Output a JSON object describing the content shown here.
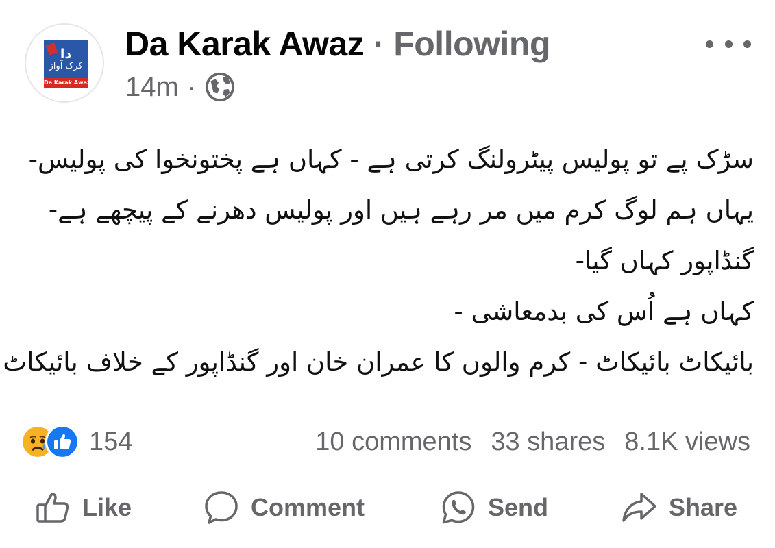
{
  "header": {
    "page_name": "Da Karak Awaz",
    "separator": "·",
    "follow_status": "Following",
    "time_ago": "14m",
    "time_separator": "·",
    "privacy_icon": "globe-icon",
    "more_icon": "more-options-icon"
  },
  "avatar": {
    "logo_mark": "دا",
    "logo_urdu": "کرک آواز",
    "logo_caption": "Da Karak Awaz"
  },
  "post": {
    "lines": [
      "سڑک پے تو پولیس پیٹرولنگ کرتی ہے - کہاں ہے پختونخوا کی پولیس-",
      "یہاں ہم لوگ کرم میں مر رہے ہیں اور پولیس دھرنے کے پیچھے ہے-",
      "گنڈاپور کہاں گیا-",
      "کہاں ہے اُس کی بدمعاشی -",
      "بائیکاٹ بائیکاٹ - کرم والوں کا عمران خان اور گنڈاپور کے خلاف بائیکاٹ"
    ]
  },
  "reactions": {
    "icons": [
      "sad-reaction-icon",
      "like-reaction-icon"
    ],
    "count": "154"
  },
  "stats": {
    "comments": "10 comments",
    "shares": "33 shares",
    "views": "8.1K views"
  },
  "actions": {
    "like": "Like",
    "comment": "Comment",
    "send": "Send",
    "share": "Share"
  },
  "colors": {
    "secondary_text": "#65676b",
    "like_blue": "#1877f2",
    "sad_yellow": "#f7b125",
    "logo_blue": "#2a57a8",
    "logo_red": "#d72a23"
  }
}
